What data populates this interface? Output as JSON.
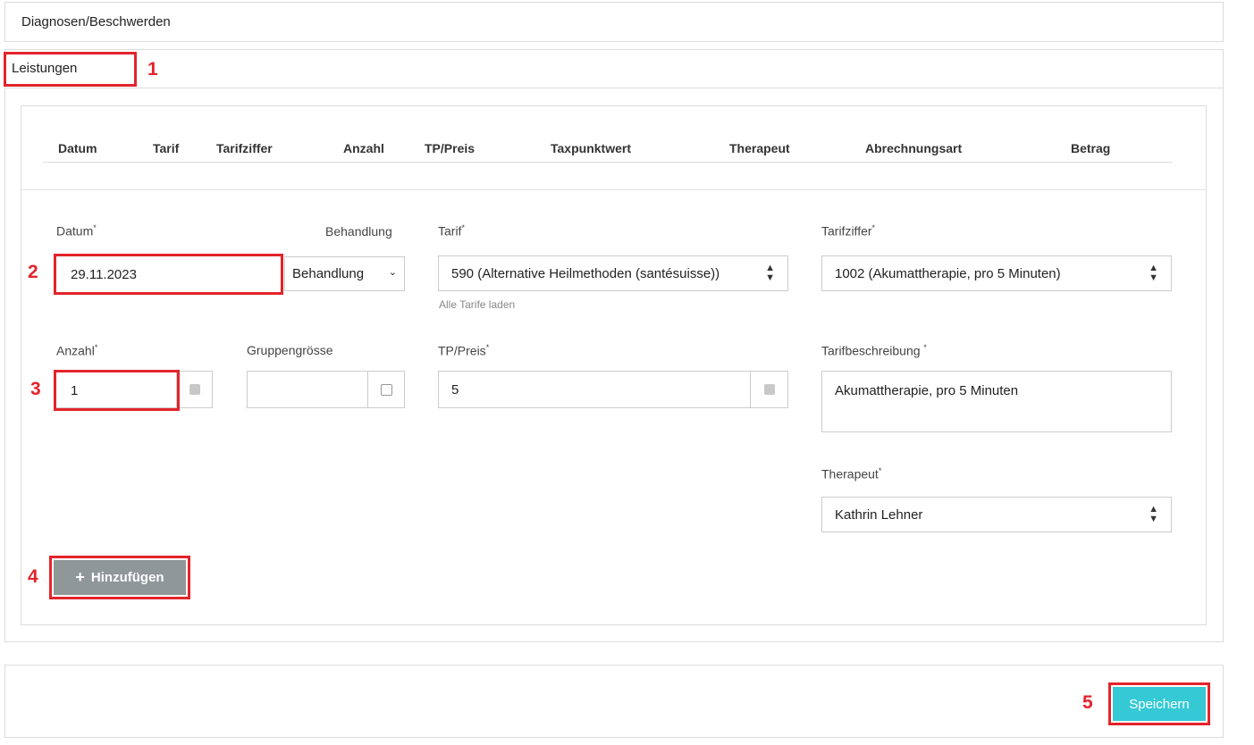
{
  "sections": {
    "diagnosen": "Diagnosen/Beschwerden",
    "leistungen": "Leistungen"
  },
  "table_headers": [
    "Datum",
    "Tarif",
    "Tarifziffer",
    "Anzahl",
    "TP/Preis",
    "Taxpunktwert",
    "Therapeut",
    "Abrechnungsart",
    "Betrag"
  ],
  "form": {
    "datum_label": "Datum",
    "datum_value": "29.11.2023",
    "behandlung_label": "Behandlung",
    "behandlung_value": "Behandlung",
    "tarif_label": "Tarif",
    "tarif_value": "590 (Alternative Heilmethoden (santésuisse))",
    "tarif_link": "Alle Tarife laden",
    "tarifziffer_label": "Tarifziffer",
    "tarifziffer_value": "1002 (Akumattherapie, pro 5 Minuten)",
    "anzahl_label": "Anzahl",
    "anzahl_value": "1",
    "gruppengroesse_label": "Gruppengrösse",
    "gruppengroesse_value": "",
    "tp_preis_label": "TP/Preis",
    "tp_preis_value": "5",
    "tarifbeschreibung_label": "Tarifbeschreibung",
    "tarifbeschreibung_value": "Akumattherapie, pro 5 Minuten",
    "therapeut_label": "Therapeut",
    "therapeut_value": "Kathrin Lehner",
    "required_mark": "*"
  },
  "buttons": {
    "add": "Hinzufügen",
    "save": "Speichern"
  },
  "annotations": [
    "1",
    "2",
    "3",
    "4",
    "5"
  ],
  "icons": {
    "add": "plus-icon",
    "select": "updown-arrows-icon",
    "dropdown": "chevron-down-icon"
  },
  "colors": {
    "highlight": "#e3242b",
    "save_button": "#35c9d6",
    "add_button": "#8f9799"
  }
}
